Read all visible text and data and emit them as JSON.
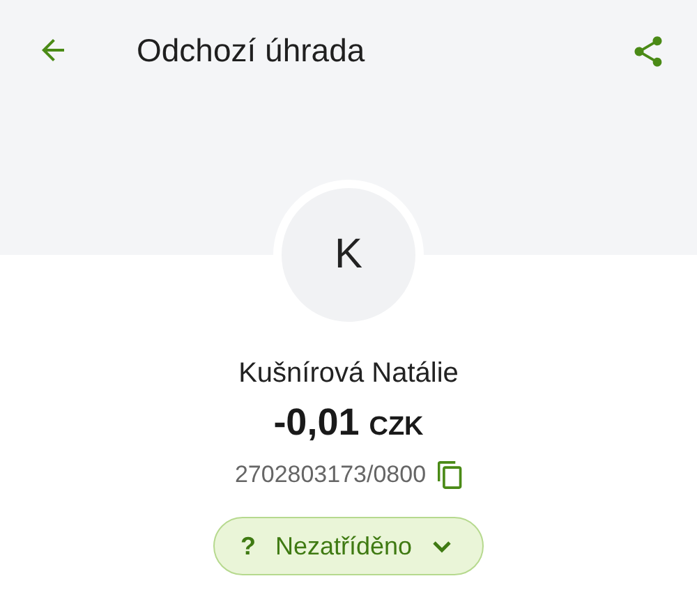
{
  "app_bar": {
    "title": "Odchozí úhrada"
  },
  "avatar": {
    "initial": "K"
  },
  "counterparty": {
    "name": "Kušnírová Natálie",
    "amount": "-0,01",
    "currency": "CZK",
    "account": "2702803173/0800"
  },
  "category_chip": {
    "symbol": "?",
    "label": "Nezatříděno"
  }
}
